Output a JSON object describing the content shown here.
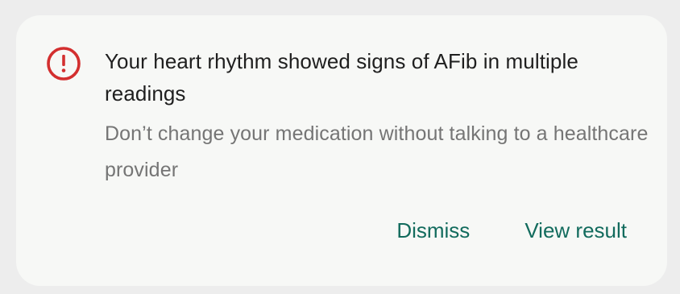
{
  "notification": {
    "icon": "alert-circle-icon",
    "icon_color": "#d32f2f",
    "title": "Your heart rhythm showed signs of AFib in multiple readings",
    "subtitle": "Don’t change your medication without talking to a healthcare provider",
    "accent_color": "#126b5d",
    "actions": {
      "dismiss_label": "Dismiss",
      "view_label": "View result"
    }
  }
}
